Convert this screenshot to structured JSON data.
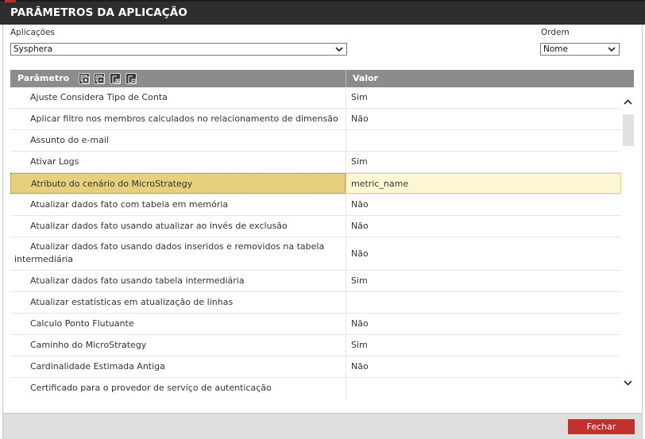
{
  "window": {
    "title": "PARÂMETROS DA APLICAÇÃO"
  },
  "filters": {
    "applications_label": "Aplicações",
    "applications_value": "Sysphera",
    "order_label": "Ordem",
    "order_value": "Nome"
  },
  "grid": {
    "columns": {
      "parameter": "Parâmetro",
      "value": "Valor"
    },
    "toolbar_icons": [
      "expand-all-icon",
      "collapse-all-icon",
      "add-node-icon",
      "remove-node-icon"
    ],
    "rows": [
      {
        "parameter": "Ajuste Considera Tipo de Conta",
        "value": "Sim"
      },
      {
        "parameter": "Aplicar filtro nos membros calculados no relacionamento de dimensão",
        "value": "Não"
      },
      {
        "parameter": "Assunto do e-mail",
        "value": ""
      },
      {
        "parameter": "Ativar Logs",
        "value": "Sim"
      },
      {
        "parameter": "Atributo do cenário do MicroStrategy",
        "value": "metric_name",
        "selected": true
      },
      {
        "parameter": "Atualizar dados fato com tabela em memória",
        "value": "Não"
      },
      {
        "parameter": "Atualizar dados fato usando atualizar ao invés de exclusão",
        "value": "Não"
      },
      {
        "parameter": "Atualizar dados fato usando dados inseridos e removidos na tabela intermediária",
        "value": "Não",
        "wrap": true
      },
      {
        "parameter": "Atualizar dados fato usando tabela intermediária",
        "value": "Sim"
      },
      {
        "parameter": "Atualizar estatísticas em atualização de linhas",
        "value": ""
      },
      {
        "parameter": "Calculo Ponto Flutuante",
        "value": "Não"
      },
      {
        "parameter": "Caminho do MicroStrategy",
        "value": "Sim"
      },
      {
        "parameter": "Cardinalidade Estimada Antiga",
        "value": "Não"
      },
      {
        "parameter": "Certificado para o provedor de serviço de autenticação",
        "value": ""
      }
    ]
  },
  "footer": {
    "close_label": "Fechar"
  },
  "colors": {
    "titlebar": "#2e2e2e",
    "header": "#8c8c8c",
    "selected_param": "#e8cf7e",
    "selected_value": "#fdf6d3",
    "close_button": "#c0312c"
  }
}
